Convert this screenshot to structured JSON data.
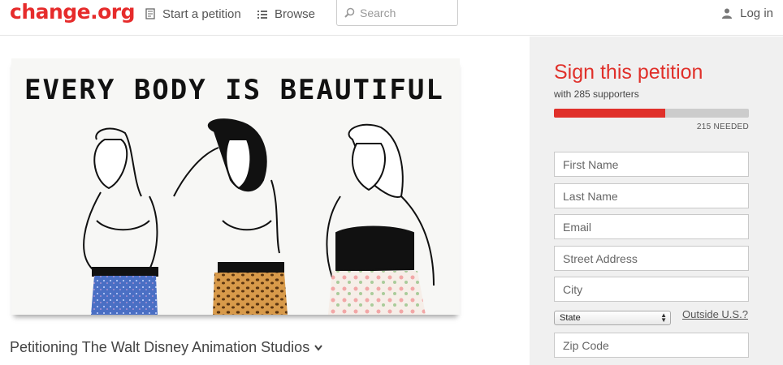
{
  "header": {
    "logo": "change.org",
    "start_petition": "Start a petition",
    "browse": "Browse",
    "search_placeholder": "Search",
    "login": "Log in",
    "icons": {
      "start": "document-icon",
      "browse": "list-icon",
      "search": "magnifier-icon",
      "login": "user-icon"
    }
  },
  "main": {
    "image_caption": "EVERY BODY IS BEAUTIFUL",
    "petitioning": "Petitioning The Walt Disney Animation Studios"
  },
  "sidebar": {
    "title": "Sign this petition",
    "supporters": "with 285 supporters",
    "progress_fraction": 0.57,
    "needed": "215 NEEDED",
    "fields": {
      "first_name": "First Name",
      "last_name": "Last Name",
      "email": "Email",
      "street": "Street Address",
      "city": "City",
      "state": "State",
      "outside": "Outside U.S.?",
      "zip": "Zip Code"
    }
  },
  "colors": {
    "brand": "#e62b2b",
    "accent": "#e0302a",
    "sidebar_bg": "#f0f0f0"
  }
}
